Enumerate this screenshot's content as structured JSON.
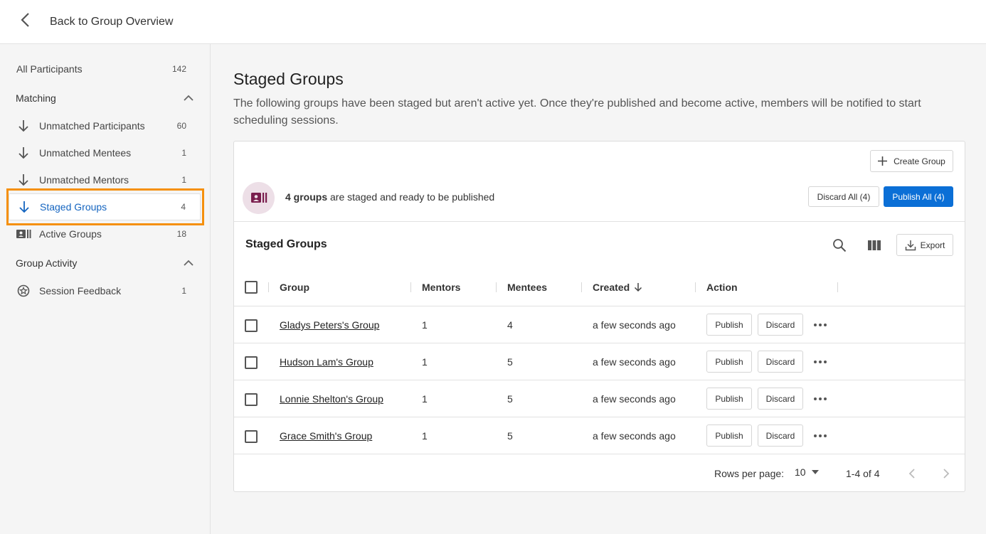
{
  "topbar": {
    "back_label": "Back to Group Overview"
  },
  "sidebar": {
    "all": {
      "label": "All Participants",
      "count": "142"
    },
    "matching": {
      "title": "Matching",
      "items": [
        {
          "label": "Unmatched Participants",
          "count": "60",
          "icon": "arrow-down-icon"
        },
        {
          "label": "Unmatched Mentees",
          "count": "1",
          "icon": "arrow-down-icon"
        },
        {
          "label": "Unmatched Mentors",
          "count": "1",
          "icon": "arrow-down-icon"
        },
        {
          "label": "Staged Groups",
          "count": "4",
          "icon": "arrow-down-icon",
          "active": true
        },
        {
          "label": "Active Groups",
          "count": "18",
          "icon": "group-card-icon"
        }
      ]
    },
    "activity": {
      "title": "Group Activity",
      "items": [
        {
          "label": "Session Feedback",
          "count": "1",
          "icon": "feedback-icon"
        }
      ]
    }
  },
  "main": {
    "title": "Staged Groups",
    "description": "The following groups have been staged but aren't active yet. Once they're published and become active, members will be notified to start scheduling sessions.",
    "create_label": "Create Group",
    "stage_count": "4 groups",
    "stage_message": " are staged and ready to be published",
    "discard_all_label": "Discard All (4)",
    "publish_all_label": "Publish All (4)",
    "table": {
      "title": "Staged Groups",
      "export_label": "Export",
      "columns": {
        "group": "Group",
        "mentors": "Mentors",
        "mentees": "Mentees",
        "created": "Created",
        "action": "Action"
      },
      "rows": [
        {
          "group": "Gladys Peters's Group",
          "mentors": "1",
          "mentees": "4",
          "created": "a few seconds ago",
          "publish": "Publish",
          "discard": "Discard"
        },
        {
          "group": "Hudson Lam's Group",
          "mentors": "1",
          "mentees": "5",
          "created": "a few seconds ago",
          "publish": "Publish",
          "discard": "Discard"
        },
        {
          "group": "Lonnie Shelton's Group",
          "mentors": "1",
          "mentees": "5",
          "created": "a few seconds ago",
          "publish": "Publish",
          "discard": "Discard"
        },
        {
          "group": "Grace Smith's Group",
          "mentors": "1",
          "mentees": "5",
          "created": "a few seconds ago",
          "publish": "Publish",
          "discard": "Discard"
        }
      ]
    },
    "footer": {
      "rows_per_page_label": "Rows per page:",
      "rows_per_page_value": "10",
      "range": "1-4 of 4"
    }
  },
  "colors": {
    "accent": "#0b6fd6",
    "highlight": "#f5900d",
    "active_text": "#1565c0"
  }
}
